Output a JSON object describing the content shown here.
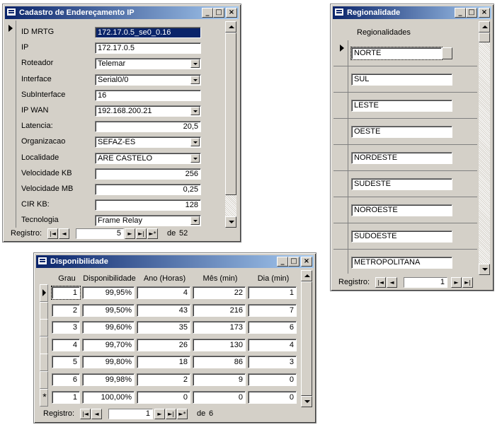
{
  "cadastro": {
    "title": "Cadastro de Endereçamento IP",
    "fields": [
      {
        "label": "ID MRTG",
        "value": "172.17.0.5_se0_0.16",
        "kind": "selected"
      },
      {
        "label": "IP",
        "value": "172.17.0.5",
        "kind": "text"
      },
      {
        "label": "Roteador",
        "value": "Telemar",
        "kind": "combo"
      },
      {
        "label": "Interface",
        "value": "Serial0/0",
        "kind": "combo"
      },
      {
        "label": "SubInterface",
        "value": "16",
        "kind": "text"
      },
      {
        "label": "IP WAN",
        "value": "192.168.200.21",
        "kind": "combo"
      },
      {
        "label": "Latencia:",
        "value": "20,5",
        "kind": "num"
      },
      {
        "label": "Organizacao",
        "value": "SEFAZ-ES",
        "kind": "combo"
      },
      {
        "label": "Localidade",
        "value": "ARE CASTELO",
        "kind": "combo"
      },
      {
        "label": "Velocidade KB",
        "value": "256",
        "kind": "num"
      },
      {
        "label": "Velocidade MB",
        "value": "0,25",
        "kind": "num"
      },
      {
        "label": "CIR KB:",
        "value": "128",
        "kind": "num"
      },
      {
        "label": "Tecnologia",
        "value": "Frame Relay",
        "kind": "combo"
      }
    ],
    "nav": {
      "label": "Registro:",
      "current": "5",
      "of_label": "de",
      "total": "52"
    }
  },
  "regionalidade": {
    "title": "Regionalidade",
    "header": "Regionalidades",
    "rows": [
      "NORTE",
      "SUL",
      "LESTE",
      "OESTE",
      "NORDESTE",
      "SUDESTE",
      "NOROESTE",
      "SUDOESTE",
      "METROPOLITANA"
    ],
    "nav": {
      "label": "Registro:",
      "current": "1"
    }
  },
  "disponibilidade": {
    "title": "Disponibilidade",
    "columns": [
      "Grau",
      "Disponibilidade",
      "Ano (Horas)",
      "Mês (min)",
      "Dia (min)"
    ],
    "rows": [
      [
        "1",
        "99,95%",
        "4",
        "22",
        "1"
      ],
      [
        "2",
        "99,50%",
        "43",
        "216",
        "7"
      ],
      [
        "3",
        "99,60%",
        "35",
        "173",
        "6"
      ],
      [
        "4",
        "99,70%",
        "26",
        "130",
        "4"
      ],
      [
        "5",
        "99,80%",
        "18",
        "86",
        "3"
      ],
      [
        "6",
        "99,98%",
        "2",
        "9",
        "0"
      ],
      [
        "1",
        "100,00%",
        "0",
        "0",
        "0"
      ]
    ],
    "nav": {
      "label": "Registro:",
      "current": "1",
      "of_label": "de",
      "total": "6"
    }
  },
  "window_buttons": {
    "minimize": "_",
    "restore": "□",
    "close": "×"
  },
  "nav_glyphs": {
    "first": "|◄",
    "prev": "◄",
    "next": "►",
    "last": "►|",
    "new": "►*"
  },
  "icons": {
    "app": "form-icon",
    "record_current": "record-pointer-icon",
    "record_new": "*"
  }
}
